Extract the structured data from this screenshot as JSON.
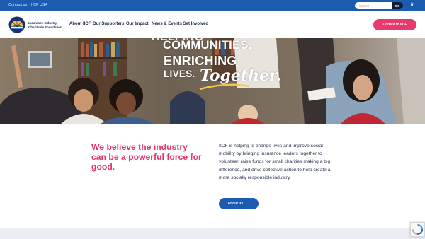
{
  "topbar": {
    "links": [
      "Contact us",
      "IICF USA"
    ],
    "search_placeholder": "Search",
    "search_button": "GO",
    "social_icon_label": "in"
  },
  "nav": {
    "logo_lines": [
      "Insurance Industry",
      "Charitable Foundation"
    ],
    "items": [
      "About IICF",
      "Our Supporters",
      "Our Impact",
      "News & Events",
      "Get Involved"
    ],
    "donate_label": "Donate to IICF"
  },
  "hero": {
    "line1": "HELPING",
    "line2": "COMMUNITIES.",
    "line3": "ENRICHING",
    "line4": "LIVES.",
    "script": "Together."
  },
  "intro": {
    "headline": "We believe the industry can be a powerful force for good.",
    "body": "IICF is helping to change lives and improve social mobility by bringing insurance leaders together to volunteer, raise funds for small charities making a big difference, and drive collective action to help create a more socially responsible industry.",
    "button_label": "About us"
  },
  "colors": {
    "brand_blue": "#1c5cb0",
    "accent_pink": "#e83a6e",
    "navy": "#1d2f6b",
    "underline_yellow": "#f2c84b"
  }
}
